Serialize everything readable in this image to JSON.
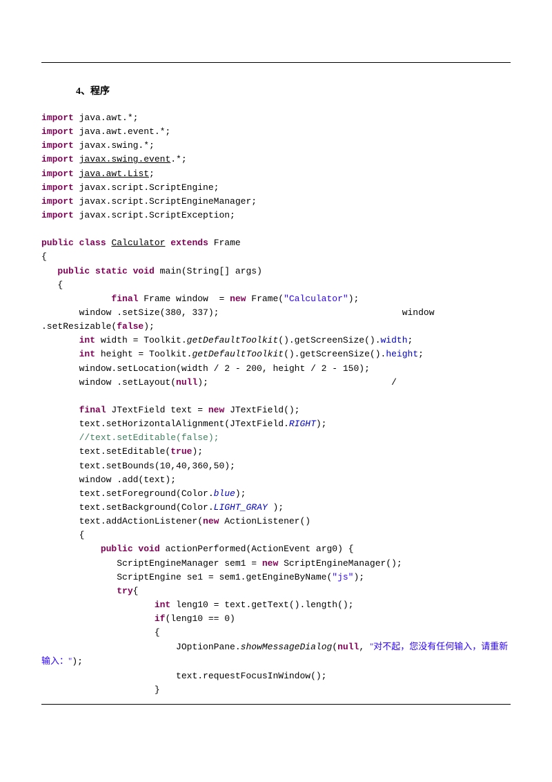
{
  "section_title": "4、程序",
  "code": {
    "l01": {
      "kw": "import",
      "rest": " java.awt.*;"
    },
    "l02": {
      "kw": "import",
      "rest": " java.awt.event.*;"
    },
    "l03": {
      "kw": "import",
      "rest": " javax.swing.*;"
    },
    "l04": {
      "kw": "import",
      "pkg": "javax.swing.event",
      "rest2": ".*;"
    },
    "l05": {
      "kw": "import",
      "pkg": "java.awt.List",
      "rest2": ";"
    },
    "l06": {
      "kw": "import",
      "rest": " javax.script.ScriptEngine;"
    },
    "l07": {
      "kw": "import",
      "rest": " javax.script.ScriptEngineManager;"
    },
    "l08": {
      "kw": "import",
      "rest": " javax.script.ScriptException;"
    },
    "l10": {
      "kw1": "public",
      "kw2": "class",
      "cls": "Calculator",
      "kw3": "extends",
      "sup": " Frame"
    },
    "l11": "{",
    "l12": {
      "ind": "   ",
      "kw": "public static void",
      "rest": " main(String[] args)"
    },
    "l13": "   {",
    "l14": {
      "ind": "             ",
      "kw1": "final",
      "t1": " Frame window  = ",
      "kw2": "new",
      "t2": " Frame(",
      "str": "\"Calculator\"",
      "t3": ");"
    },
    "l15a": "       window .setSize(380, 337);",
    "l15b": "window",
    "l16": {
      "a": ".setResizable(",
      "kw": "false",
      "b": ");"
    },
    "l17": {
      "ind": "       ",
      "kw": "int",
      "a": " width = Toolkit.",
      "m": "getDefaultToolkit",
      "b": "().getScreenSize().",
      "f": "width",
      "c": ";"
    },
    "l18": {
      "ind": "       ",
      "kw": "int",
      "a": " height = Toolkit.",
      "m": "getDefaultToolkit",
      "b": "().getScreenSize().",
      "f": "height",
      "c": ";"
    },
    "l19": "       window.setLocation(width / 2 - 200, height / 2 - 150);",
    "l20": {
      "a": "       window .setLayout(",
      "kw": "null",
      "b": ");",
      "pad": "                                  /"
    },
    "l22": {
      "ind": "       ",
      "kw1": "final",
      "a": " JTextField text = ",
      "kw2": "new",
      "b": " JTextField();"
    },
    "l23": {
      "a": "       text.setHorizontalAlignment(JTextField.",
      "f": "RIGHT",
      "b": ");"
    },
    "l24": {
      "com": "       //text.setEditable(false);"
    },
    "l25": {
      "a": "       text.setEditable(",
      "kw": "true",
      "b": ");"
    },
    "l26": "       text.setBounds(10,40,360,50);",
    "l27": "       window .add(text);",
    "l28": {
      "a": "       text.setForeground(Color.",
      "f": "blue",
      "b": ");"
    },
    "l29": {
      "a": "       text.setBackground(Color.",
      "f": "LIGHT_GRAY ",
      "b": ");"
    },
    "l30": {
      "a": "       text.addActionListener(",
      "kw": "new",
      "b": " ActionListener()"
    },
    "l31": "       {",
    "l32": {
      "ind": "           ",
      "kw": "public void",
      "a": " actionPerformed(ActionEvent arg0) {"
    },
    "l33": {
      "a": "              ScriptEngineManager sem1 = ",
      "kw": "new",
      "b": " ScriptEngineManager();"
    },
    "l34": {
      "a": "              ScriptEngine se1 = sem1.getEngineByName(",
      "str": "\"js\"",
      "b": ");"
    },
    "l35": {
      "ind": "              ",
      "kw": "try",
      "a": "{"
    },
    "l36": {
      "ind": "                     ",
      "kw": "int",
      "a": " leng10 = text.getText().length();"
    },
    "l37": {
      "ind": "                     ",
      "kw": "if",
      "a": "(leng10 == 0)"
    },
    "l38": "                     {",
    "l39": {
      "a": "                         JOptionPane.",
      "m": "showMessageDialog",
      "b": "(",
      "kw": "null",
      "c": ", ",
      "str": "\"对不起，您没有任何输入，请重新输入：\"",
      "d": ");"
    },
    "l40": "                         text.requestFocusInWindow();",
    "l41": "                     }"
  }
}
